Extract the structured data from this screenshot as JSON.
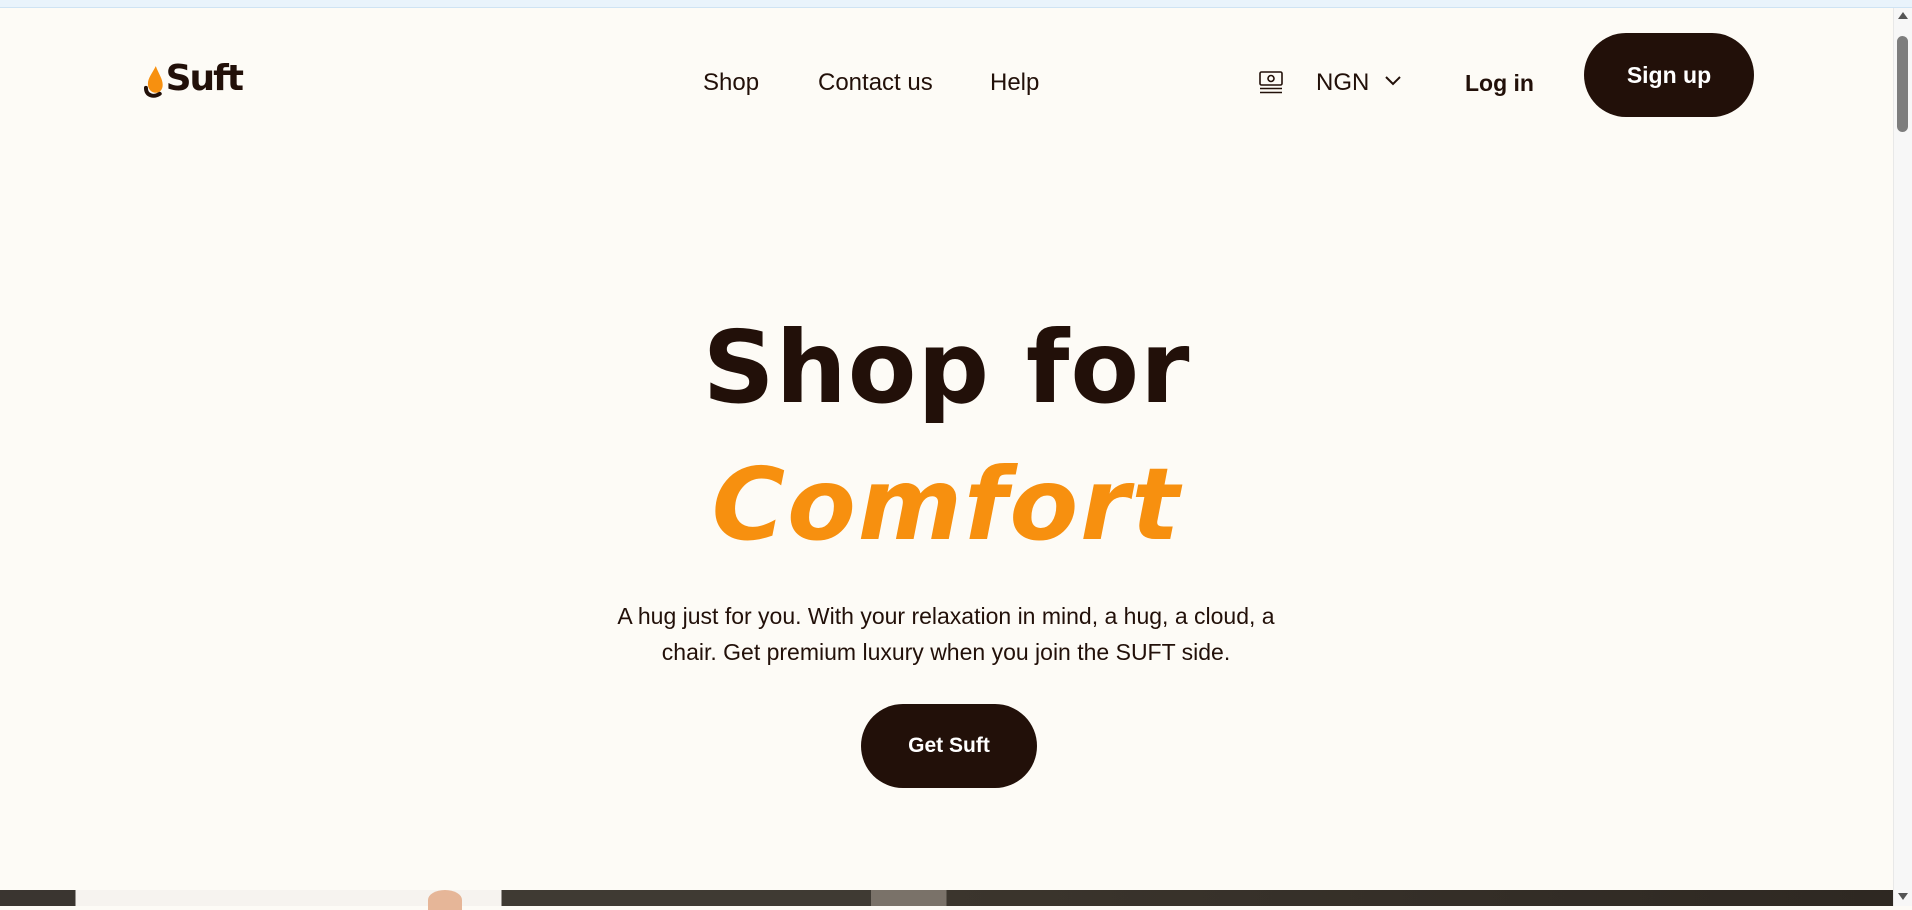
{
  "brand": {
    "name": "Suft",
    "accent_color": "#f7900f",
    "dark_color": "#221009",
    "background_color": "#fdfbf6"
  },
  "nav": {
    "items": [
      {
        "label": "Shop"
      },
      {
        "label": "Contact us"
      },
      {
        "label": "Help"
      }
    ]
  },
  "currency": {
    "icon": "cash-icon",
    "code": "NGN",
    "dropdown_icon": "chevron-down-icon"
  },
  "auth": {
    "login_label": "Log in",
    "signup_label": "Sign up"
  },
  "hero": {
    "title_line1": "Shop for",
    "title_line2": "Comfort",
    "description": "A hug just for you. With your relaxation in mind, a hug, a cloud, a chair. Get premium luxury when you join the SUFT side.",
    "cta_label": "Get Suft"
  }
}
